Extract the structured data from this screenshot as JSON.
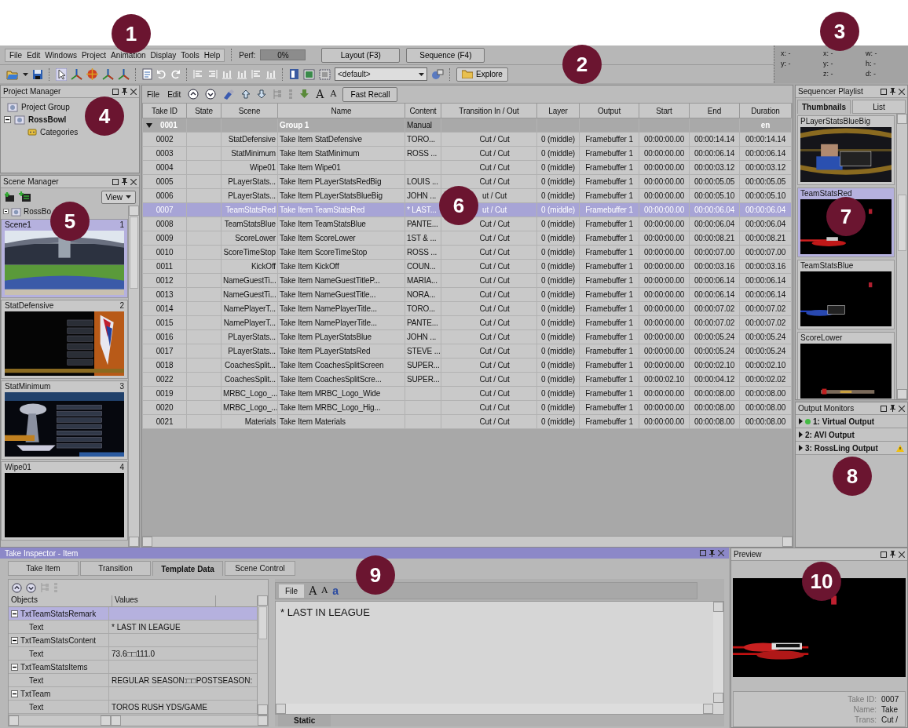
{
  "callouts": [
    "1",
    "2",
    "3",
    "4",
    "5",
    "6",
    "7",
    "8",
    "9",
    "10"
  ],
  "menu": [
    "File",
    "Edit",
    "Windows",
    "Project",
    "Animation",
    "Display",
    "Tools",
    "Help"
  ],
  "perf": {
    "label": "Perf:",
    "reading": "0%"
  },
  "mode_buttons": [
    "Layout (F3)",
    "Sequence (F4)"
  ],
  "coords": [
    [
      "x: -",
      "y: -"
    ],
    [
      "x: -",
      "y: -",
      "z: -"
    ],
    [
      "w: -",
      "h: -",
      "d: -"
    ]
  ],
  "toolbar": {
    "layout_select": "<default>",
    "explore": "Explore"
  },
  "project_manager": {
    "title": "Project Manager",
    "tree": [
      {
        "label": "Project Group",
        "bold": false
      },
      {
        "label": "RossBowl",
        "bold": true,
        "expanded": true,
        "children": [
          {
            "label": "Categories",
            "bold": false
          }
        ]
      }
    ]
  },
  "scene_manager": {
    "title": "Scene Manager",
    "view": "View",
    "root": "RossBo",
    "scenes": [
      {
        "name": "Scene1",
        "number": "1",
        "selected": true
      },
      {
        "name": "StatDefensive",
        "number": "2",
        "selected": false
      },
      {
        "name": "StatMinimum",
        "number": "3",
        "selected": false
      },
      {
        "name": "Wipe01",
        "number": "4",
        "selected": false
      }
    ]
  },
  "sequence": {
    "menu": [
      "File",
      "Edit"
    ],
    "font_buttons": [
      "A",
      "A"
    ],
    "fast_recall": "Fast Recall",
    "columns": [
      "Take ID",
      "State",
      "Scene",
      "Name",
      "Content",
      "Transition In / Out",
      "Layer",
      "Output",
      "Start",
      "End",
      "Duration"
    ],
    "rows": [
      {
        "kind": "group",
        "expanded": true,
        "selected": false,
        "cells": [
          "0001",
          "",
          "",
          "Group 1",
          "Manual",
          "",
          "",
          "",
          "",
          "",
          "en"
        ]
      },
      {
        "kind": "item",
        "selected": false,
        "cells": [
          "0002",
          "",
          "StatDefensive",
          "Take Item StatDefensive",
          "TORO...",
          "Cut / Cut",
          "0 (middle)",
          "Framebuffer 1",
          "00:00:00.00",
          "00:00:14.14",
          "00:00:14.14"
        ]
      },
      {
        "kind": "item",
        "selected": false,
        "cells": [
          "0003",
          "",
          "StatMinimum",
          "Take Item StatMinimum",
          "ROSS ...",
          "Cut / Cut",
          "0 (middle)",
          "Framebuffer 1",
          "00:00:00.00",
          "00:00:06.14",
          "00:00:06.14"
        ]
      },
      {
        "kind": "item",
        "selected": false,
        "cells": [
          "0004",
          "",
          "Wipe01",
          "Take Item Wipe01",
          "",
          "Cut / Cut",
          "0 (middle)",
          "Framebuffer 1",
          "00:00:00.00",
          "00:00:03.12",
          "00:00:03.12"
        ]
      },
      {
        "kind": "item",
        "selected": false,
        "cells": [
          "0005",
          "",
          "PLayerStats...",
          "Take Item PLayerStatsRedBig",
          "LOUIS ...",
          "Cut / Cut",
          "0 (middle)",
          "Framebuffer 1",
          "00:00:00.00",
          "00:00:05.05",
          "00:00:05.05"
        ]
      },
      {
        "kind": "item",
        "selected": false,
        "cells": [
          "0006",
          "",
          "PLayerStats...",
          "Take Item PLayerStatsBlueBig",
          "JOHN ...",
          "ut / Cut",
          "0 (middle)",
          "Framebuffer 1",
          "00:00:00.00",
          "00:00:05.10",
          "00:00:05.10"
        ]
      },
      {
        "kind": "item",
        "selected": true,
        "cells": [
          "0007",
          "",
          "TeamStatsRed",
          "Take Item TeamStatsRed",
          "* LAST...",
          "ut / Cut",
          "0 (middle)",
          "Framebuffer 1",
          "00:00:00.00",
          "00:00:06.04",
          "00:00:06.04"
        ]
      },
      {
        "kind": "item",
        "selected": false,
        "cells": [
          "0008",
          "",
          "TeamStatsBlue",
          "Take Item TeamStatsBlue",
          "PANTE...",
          "Cut / Cut",
          "0 (middle)",
          "Framebuffer 1",
          "00:00:00.00",
          "00:00:06.04",
          "00:00:06.04"
        ]
      },
      {
        "kind": "item",
        "selected": false,
        "cells": [
          "0009",
          "",
          "ScoreLower",
          "Take Item ScoreLower",
          "1ST & ...",
          "Cut / Cut",
          "0 (middle)",
          "Framebuffer 1",
          "00:00:00.00",
          "00:00:08.21",
          "00:00:08.21"
        ]
      },
      {
        "kind": "item",
        "selected": false,
        "cells": [
          "0010",
          "",
          "ScoreTimeStop",
          "Take Item ScoreTimeStop",
          "ROSS ...",
          "Cut / Cut",
          "0 (middle)",
          "Framebuffer 1",
          "00:00:00.00",
          "00:00:07.00",
          "00:00:07.00"
        ]
      },
      {
        "kind": "item",
        "selected": false,
        "cells": [
          "0011",
          "",
          "KickOff",
          "Take Item KickOff",
          "COUN...",
          "Cut / Cut",
          "0 (middle)",
          "Framebuffer 1",
          "00:00:00.00",
          "00:00:03.16",
          "00:00:03.16"
        ]
      },
      {
        "kind": "item",
        "selected": false,
        "cells": [
          "0012",
          "",
          "NameGuestTi...",
          "Take Item NameGuestTitleP...",
          "MARIA...",
          "Cut / Cut",
          "0 (middle)",
          "Framebuffer 1",
          "00:00:00.00",
          "00:00:06.14",
          "00:00:06.14"
        ]
      },
      {
        "kind": "item",
        "selected": false,
        "cells": [
          "0013",
          "",
          "NameGuestTi...",
          "Take Item NameGuestTitle...",
          "NORA...",
          "Cut / Cut",
          "0 (middle)",
          "Framebuffer 1",
          "00:00:00.00",
          "00:00:06.14",
          "00:00:06.14"
        ]
      },
      {
        "kind": "item",
        "selected": false,
        "cells": [
          "0014",
          "",
          "NamePlayerT...",
          "Take Item NamePlayerTitle...",
          "TORO...",
          "Cut / Cut",
          "0 (middle)",
          "Framebuffer 1",
          "00:00:00.00",
          "00:00:07.02",
          "00:00:07.02"
        ]
      },
      {
        "kind": "item",
        "selected": false,
        "cells": [
          "0015",
          "",
          "NamePlayerT...",
          "Take Item NamePlayerTitle...",
          "PANTE...",
          "Cut / Cut",
          "0 (middle)",
          "Framebuffer 1",
          "00:00:00.00",
          "00:00:07.02",
          "00:00:07.02"
        ]
      },
      {
        "kind": "item",
        "selected": false,
        "cells": [
          "0016",
          "",
          "PLayerStats...",
          "Take Item PLayerStatsBlue",
          "JOHN ...",
          "Cut / Cut",
          "0 (middle)",
          "Framebuffer 1",
          "00:00:00.00",
          "00:00:05.24",
          "00:00:05.24"
        ]
      },
      {
        "kind": "item",
        "selected": false,
        "cells": [
          "0017",
          "",
          "PLayerStats...",
          "Take Item PLayerStatsRed",
          "STEVE ...",
          "Cut / Cut",
          "0 (middle)",
          "Framebuffer 1",
          "00:00:00.00",
          "00:00:05.24",
          "00:00:05.24"
        ]
      },
      {
        "kind": "item",
        "selected": false,
        "cells": [
          "0018",
          "",
          "CoachesSplit...",
          "Take Item CoachesSplitScreen",
          "SUPER...",
          "Cut / Cut",
          "0 (middle)",
          "Framebuffer 1",
          "00:00:00.00",
          "00:00:02.10",
          "00:00:02.10"
        ]
      },
      {
        "kind": "item",
        "selected": false,
        "cells": [
          "0022",
          "",
          "CoachesSplit...",
          "Take Item CoachesSplitScre...",
          "SUPER...",
          "Cut / Cut",
          "0 (middle)",
          "Framebuffer 1",
          "00:00:02.10",
          "00:00:04.12",
          "00:00:02.02"
        ]
      },
      {
        "kind": "item",
        "selected": false,
        "cells": [
          "0019",
          "",
          "MRBC_Logo_...",
          "Take Item MRBC_Logo_Wide",
          "",
          "Cut / Cut",
          "0 (middle)",
          "Framebuffer 1",
          "00:00:00.00",
          "00:00:08.00",
          "00:00:08.00"
        ]
      },
      {
        "kind": "item",
        "selected": false,
        "cells": [
          "0020",
          "",
          "MRBC_Logo_...",
          "Take Item MRBC_Logo_Hig...",
          "",
          "Cut / Cut",
          "0 (middle)",
          "Framebuffer 1",
          "00:00:00.00",
          "00:00:08.00",
          "00:00:08.00"
        ]
      },
      {
        "kind": "item",
        "selected": false,
        "cells": [
          "0021",
          "",
          "Materials",
          "Take Item Materials",
          "",
          "Cut / Cut",
          "0 (middle)",
          "Framebuffer 1",
          "00:00:00.00",
          "00:00:08.00",
          "00:00:08.00"
        ]
      }
    ]
  },
  "sequencer_playlist": {
    "title": "Sequencer Playlist",
    "tabs": [
      {
        "label": "Thumbnails",
        "selected": true
      },
      {
        "label": "List",
        "selected": false
      }
    ],
    "items": [
      {
        "name": "PLayerStatsBlueBig",
        "selected": false
      },
      {
        "name": "TeamStatsRed",
        "selected": true
      },
      {
        "name": "TeamStatsBlue",
        "selected": false
      },
      {
        "name": "ScoreLower",
        "selected": false
      }
    ]
  },
  "output_monitors": {
    "title": "Output Monitors",
    "items": [
      {
        "label": "1: Virtual Output",
        "kind": "active"
      },
      {
        "label": "2: AVI Output",
        "kind": "plain"
      },
      {
        "label": "3: RossLing Output",
        "kind": "warning"
      }
    ]
  },
  "take_inspector": {
    "title": "Take Inspector - Item",
    "tabs": [
      {
        "label": "Take Item",
        "selected": false
      },
      {
        "label": "Transition",
        "selected": false
      },
      {
        "label": "Template Data",
        "selected": true
      },
      {
        "label": "Scene Control",
        "selected": false
      }
    ],
    "columns": [
      "Objects",
      "Values"
    ],
    "objects": [
      {
        "name": "TxtTeamStatsRemark",
        "selected": true,
        "expanded": true,
        "children": [
          {
            "name": "Text",
            "value": "* LAST IN LEAGUE"
          }
        ]
      },
      {
        "name": "TxtTeamStatsContent",
        "selected": false,
        "expanded": true,
        "children": [
          {
            "name": "Text",
            "value": "73.6□□111.0"
          }
        ]
      },
      {
        "name": "TxtTeamStatsItems",
        "selected": false,
        "expanded": true,
        "children": [
          {
            "name": "Text",
            "value": "REGULAR  SEASON:□□POSTSEASON:"
          }
        ]
      },
      {
        "name": "TxtTeam",
        "selected": false,
        "expanded": true,
        "children": [
          {
            "name": "Text",
            "value": "TOROS RUSH YDS/GAME"
          }
        ]
      }
    ],
    "editor": {
      "file_tab": "File",
      "font_buttons": [
        "A",
        "A"
      ],
      "style_button": "a",
      "text": "* LAST IN LEAGUE",
      "bottom_tab": "Static"
    }
  },
  "preview": {
    "title": "Preview",
    "info": [
      {
        "label": "Take ID:",
        "value": "0007"
      },
      {
        "label": "Name:",
        "value": "Take"
      },
      {
        "label": "Trans:",
        "value": "Cut /"
      }
    ]
  }
}
